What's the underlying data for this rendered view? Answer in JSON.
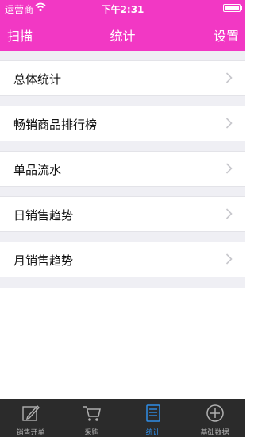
{
  "status": {
    "carrier": "运营商",
    "time": "下午2:31"
  },
  "nav": {
    "left_label": "扫描",
    "title": "统计",
    "right_label": "设置"
  },
  "menu": [
    {
      "label": "总体统计"
    },
    {
      "label": "畅销商品排行榜"
    },
    {
      "label": "单品流水"
    },
    {
      "label": "日销售趋势"
    },
    {
      "label": "月销售趋势"
    }
  ],
  "tabs": [
    {
      "label": "销售开单",
      "icon": "pencil-icon"
    },
    {
      "label": "采购",
      "icon": "cart-icon"
    },
    {
      "label": "统计",
      "icon": "document-icon",
      "active": true
    },
    {
      "label": "基础数据",
      "icon": "plus-circle-icon"
    }
  ],
  "colors": {
    "accent": "#f238c4",
    "active_tab": "#2f8ee8",
    "tabbar_bg": "#2b2b2b"
  }
}
